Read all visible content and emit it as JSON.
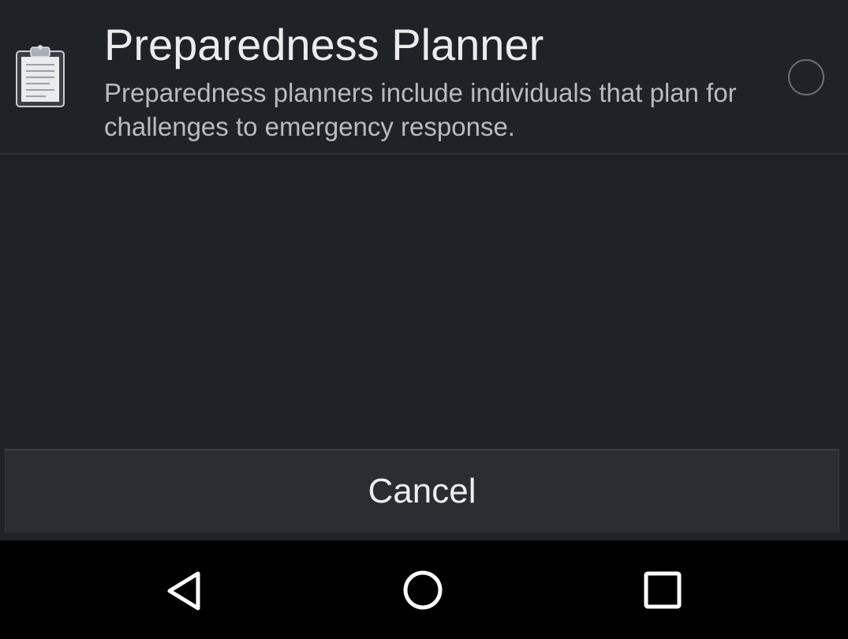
{
  "option": {
    "title": "Preparedness Planner",
    "description": "Preparedness planners include individuals that plan for challenges to emergency response.",
    "icon": "clipboard-icon",
    "selected": false
  },
  "actions": {
    "cancel_label": "Cancel"
  },
  "navbar": {
    "back_icon": "back-triangle-icon",
    "home_icon": "home-circle-icon",
    "recents_icon": "recents-square-icon"
  },
  "colors": {
    "background": "#1f2227",
    "title": "#ececec",
    "description": "#b9bbbe",
    "button": "#2a2e33",
    "navbar": "#000000"
  }
}
